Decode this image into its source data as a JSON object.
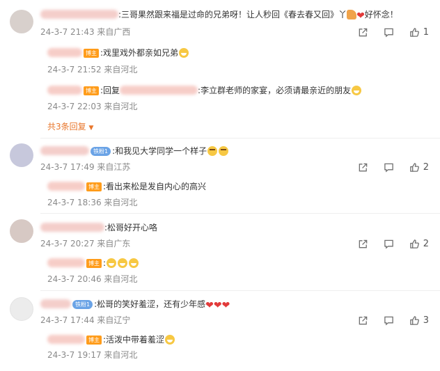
{
  "comments": [
    {
      "text": ":三哥果然跟来福是过命的兄弟呀！让人秒回《春去春又回》",
      "text_tail": "好怀念！",
      "time": "24-3-7 21:43 来自广西",
      "likes": "1",
      "replies": [
        {
          "badge": "博主",
          "text": ":戏里戏外都亲如兄弟",
          "time": "24-3-7 21:52 来自河北"
        },
        {
          "badge": "博主",
          "prefix": ":回复",
          "text": ":李立群老师的家宴，必须请最亲近的朋友",
          "time": "24-3-7 22:03 来自河北"
        }
      ],
      "more_replies": "共3条回复"
    },
    {
      "fan_badge": "铁粉1",
      "text": ":和我见大学同学一个样子",
      "time": "24-3-7 17:49 来自江苏",
      "likes": "2",
      "replies": [
        {
          "badge": "博主",
          "text": ":看出来松是发自内心的高兴",
          "time": "24-3-7 18:36 来自河北"
        }
      ]
    },
    {
      "text": ":松哥好开心咯",
      "time": "24-3-7 20:27 来自广东",
      "likes": "2",
      "replies": [
        {
          "badge": "博主",
          "text": ":",
          "time": "24-3-7 20:46 来自河北"
        }
      ]
    },
    {
      "fan_badge": "铁粉1",
      "text": ":松哥的笑好羞涩，还有少年感",
      "time": "24-3-7 17:44 来自辽宁",
      "likes": "3",
      "replies": [
        {
          "badge": "博主",
          "text": ":活泼中带着羞涩",
          "time": "24-3-7 19:17 来自河北"
        }
      ]
    }
  ],
  "colors": {
    "accent": "#e8762b",
    "badge": "#ff9c1a",
    "fan_badge": "#6aa3e6",
    "meta": "#8a8a8a",
    "heart": "#e23a3a"
  },
  "icons": {
    "share": "share-icon",
    "comment": "comment-icon",
    "like": "like-icon"
  }
}
